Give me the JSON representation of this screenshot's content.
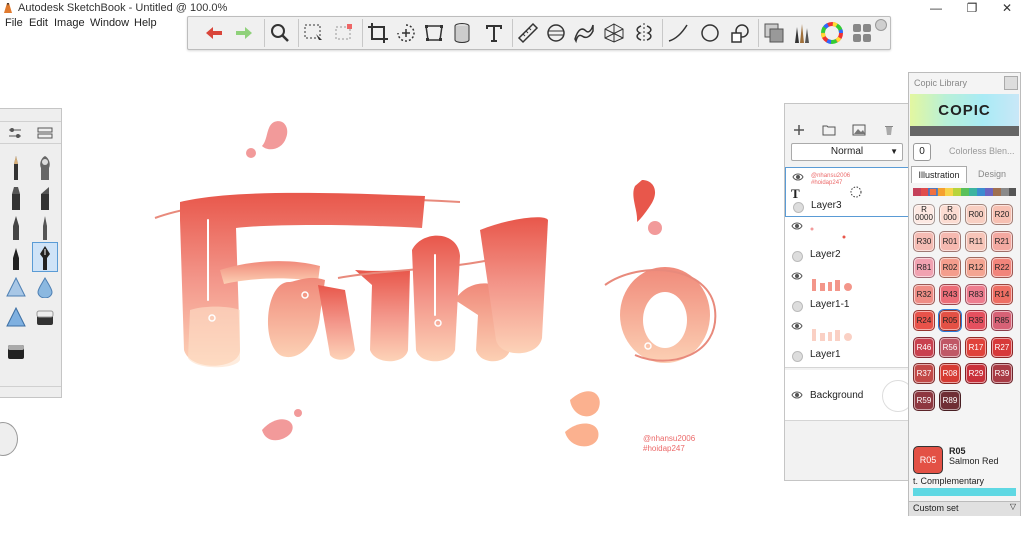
{
  "window": {
    "title": "Autodesk SketchBook - Untitled @ 100.0%",
    "minimize": "—",
    "maximize": "❐",
    "close": "✕"
  },
  "menu": [
    "File",
    "Edit",
    "Image",
    "Window",
    "Help"
  ],
  "toolbar": {
    "icons": [
      "undo-icon",
      "redo-icon",
      "zoom-icon",
      "select-icon",
      "lasso-select-icon",
      "crop-icon",
      "transform-icon",
      "distort-icon",
      "cylinder-icon",
      "text-icon",
      "ruler-icon",
      "ellipse-guide-icon",
      "french-curve-icon",
      "perspective-icon",
      "symmetry-icon",
      "line-icon",
      "circle-icon",
      "shapes-icon",
      "layer-stack-icon",
      "brush-library-icon",
      "color-wheel-icon",
      "copic-library-icon"
    ]
  },
  "brushes": {
    "selected": "ink-pen",
    "items": [
      "pencil",
      "smudge",
      "marker",
      "chisel-marker",
      "pen",
      "sharp-pen",
      "fine-pen",
      "ink-pen",
      "airbrush",
      "water-drop",
      "triangle",
      "eraser",
      "hard-eraser"
    ]
  },
  "canvas": {
    "art_text": "Fatho",
    "signature_line1": "@nhansu2006",
    "signature_line2": "#hoidap247"
  },
  "layers": {
    "blend_mode": "Normal",
    "items": [
      {
        "name": "Layer3",
        "selected": true
      },
      {
        "name": "Layer2",
        "selected": false
      },
      {
        "name": "Layer1-1",
        "selected": false
      },
      {
        "name": "Layer1",
        "selected": false
      }
    ],
    "background": "Background",
    "layer3_thumb_text1": "@nhansu2006",
    "layer3_thumb_text2": "#hoidap247"
  },
  "copic": {
    "title": "Copic Library",
    "logo": "COPIC",
    "colorless_code": "0",
    "colorless_label": "Colorless Blen...",
    "tabs": [
      "Illustration",
      "Design"
    ],
    "active_tab": "Illustration",
    "swatches": [
      {
        "code": "R\n0000",
        "color": "#fde9e3"
      },
      {
        "code": "R\n000",
        "color": "#fcdcd2"
      },
      {
        "code": "R00",
        "color": "#f8cfc2"
      },
      {
        "code": "R20",
        "color": "#f7c0b2"
      },
      {
        "code": "R30",
        "color": "#f5bcb4"
      },
      {
        "code": "R01",
        "color": "#f6b9b0"
      },
      {
        "code": "R11",
        "color": "#f7c5b9"
      },
      {
        "code": "R21",
        "color": "#f4a9a1"
      },
      {
        "code": "R81",
        "color": "#f1a2b1"
      },
      {
        "code": "R02",
        "color": "#f49d8d"
      },
      {
        "code": "R12",
        "color": "#f4a592"
      },
      {
        "code": "R22",
        "color": "#f2857b"
      },
      {
        "code": "R32",
        "color": "#ef8d85"
      },
      {
        "code": "R43",
        "color": "#ec6d78"
      },
      {
        "code": "R83",
        "color": "#ee7d8f"
      },
      {
        "code": "R14",
        "color": "#ee6e63"
      },
      {
        "code": "R24",
        "color": "#e8534a"
      },
      {
        "code": "R05",
        "color": "#e35145"
      },
      {
        "code": "R35",
        "color": "#e5505f"
      },
      {
        "code": "R85",
        "color": "#d76276"
      },
      {
        "code": "R46",
        "color": "#c9414f"
      },
      {
        "code": "R56",
        "color": "#c05866"
      },
      {
        "code": "R17",
        "color": "#e0433b"
      },
      {
        "code": "R27",
        "color": "#d7393a"
      },
      {
        "code": "R37",
        "color": "#c24947"
      },
      {
        "code": "R08",
        "color": "#d63b33"
      },
      {
        "code": "R29",
        "color": "#c9303a"
      },
      {
        "code": "R39",
        "color": "#a93b45"
      },
      {
        "code": "R59",
        "color": "#8e3840"
      },
      {
        "code": "R89",
        "color": "#6f2e35"
      }
    ],
    "selected_code": "R05",
    "selected_name": "Salmon Red",
    "complementary_label": "t. Complementary",
    "complementary_color": "#5fd8e3",
    "custom_set_label": "Custom set"
  }
}
